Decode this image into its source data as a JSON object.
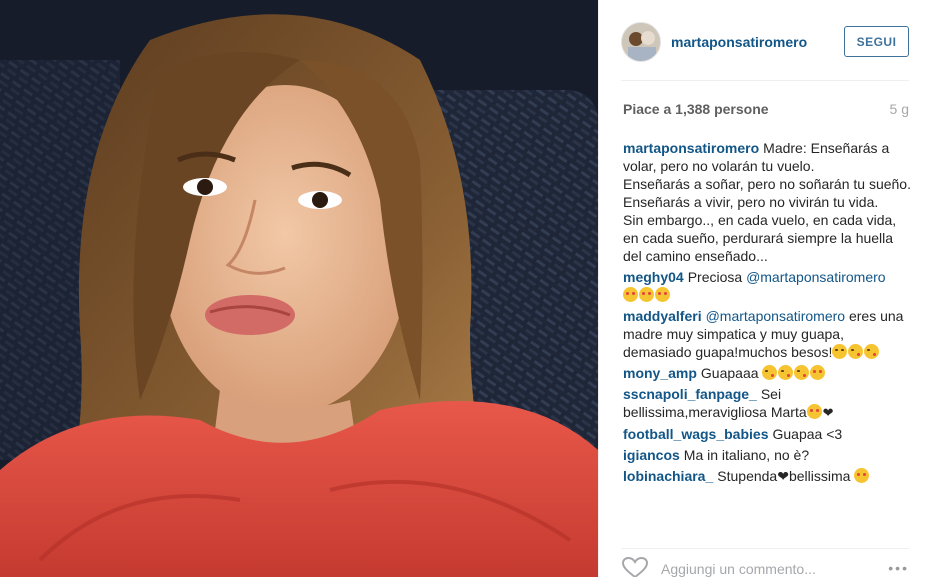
{
  "post": {
    "username": "martaponsatiromero",
    "follow_label": "SEGUI",
    "likes": "Piace a 1,388 persone",
    "age": "5 g",
    "caption": {
      "author": "martaponsatiromero",
      "lines": [
        "Madre: Enseñarás a volar, pero no volarán tu vuelo.",
        "Enseñarás a soñar, pero no soñarán tu sueño.",
        "Enseñarás a vivir, pero no vivirán tu vida.",
        "Sin embargo.., en cada vuelo, en cada vida, en cada sueño, perdurará siempre la huella del camino enseñado..."
      ]
    },
    "comments": [
      {
        "author": "meghy04",
        "text": "Preciosa ",
        "mention": "@martaponsatiromero",
        "emojis": [
          "heart-eyes",
          "heart-eyes",
          "heart-eyes"
        ]
      },
      {
        "author": "maddyalferi",
        "mention_first": "@martaponsatiromero",
        "text": " eres una madre muy simpatica y muy guapa, demasiado guapa!muchos besos!",
        "emojis": [
          "wink",
          "kiss",
          "kiss"
        ]
      },
      {
        "author": "mony_amp",
        "text": "Guapaaa ",
        "emojis": [
          "kiss",
          "kiss",
          "kiss",
          "heart-eyes"
        ]
      },
      {
        "author": "sscnapoli_fanpage_",
        "text": "Sei bellissima,meravigliosa Marta",
        "emojis": [
          "heart-eyes"
        ],
        "suffix": "❤"
      },
      {
        "author": "football_wags_babies",
        "text": "Guapaa <3"
      },
      {
        "author": "igiancos",
        "text": "Ma in italiano, no è?"
      },
      {
        "author": "lobinachiara_",
        "text": "Stupenda❤bellissima ",
        "emojis": [
          "heart-eyes"
        ]
      }
    ],
    "add_comment_placeholder": "Aggiungi un commento...",
    "more_label": "•••"
  },
  "icons": {
    "like": "heart-outline-icon",
    "more": "ellipsis-icon"
  },
  "colors": {
    "link": "#125688",
    "follow": "#3f729b",
    "muted": "#a5a7aa"
  }
}
